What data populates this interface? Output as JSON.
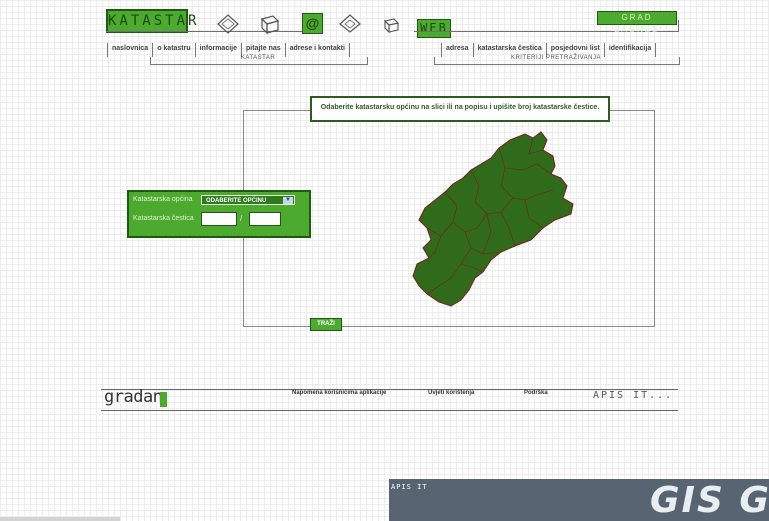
{
  "header": {
    "logo": "KATASTAR",
    "web_label": "WEB",
    "grad_label": "GRAD ZAGREB",
    "at_icon": "at-sign-icon"
  },
  "nav_left": {
    "items": [
      "naslovnica",
      "o katastru",
      "informacije",
      "pitajte nas",
      "adrese i kontakti"
    ],
    "section_label": "KATASTAR"
  },
  "nav_right": {
    "items": [
      "adresa",
      "katastarska čestica",
      "posjedovni list",
      "identifikacija"
    ],
    "section_label": "KRITERIJI PRETRAŽIVANJA"
  },
  "main": {
    "instruction": "Odaberite katastarsku općinu na slici ili na popisu i upišite broj katastarske čestice.",
    "form": {
      "municipality_label": "Katastarska općina",
      "municipality_value": "ODABERITE OPĆINU",
      "parcel_label": "Katastarska čestica",
      "parcel_number": "",
      "parcel_sub": "",
      "slash": "/"
    },
    "search_button": "TRAŽI",
    "map_color": "#2f6b1a",
    "map_border": "#7a1e1e"
  },
  "footer": {
    "brand": "gradan",
    "links": [
      "Napomena korisnicima aplikacije",
      "Uvjeti korištenja",
      "Podrška"
    ],
    "apis": "APIS IT..."
  },
  "banner": {
    "label": "APIS IT",
    "logo_text": "GIS GR"
  },
  "colors": {
    "accent_green": "#4caa2e",
    "dark_green": "#1e5a10",
    "banner_bg": "#586472"
  }
}
